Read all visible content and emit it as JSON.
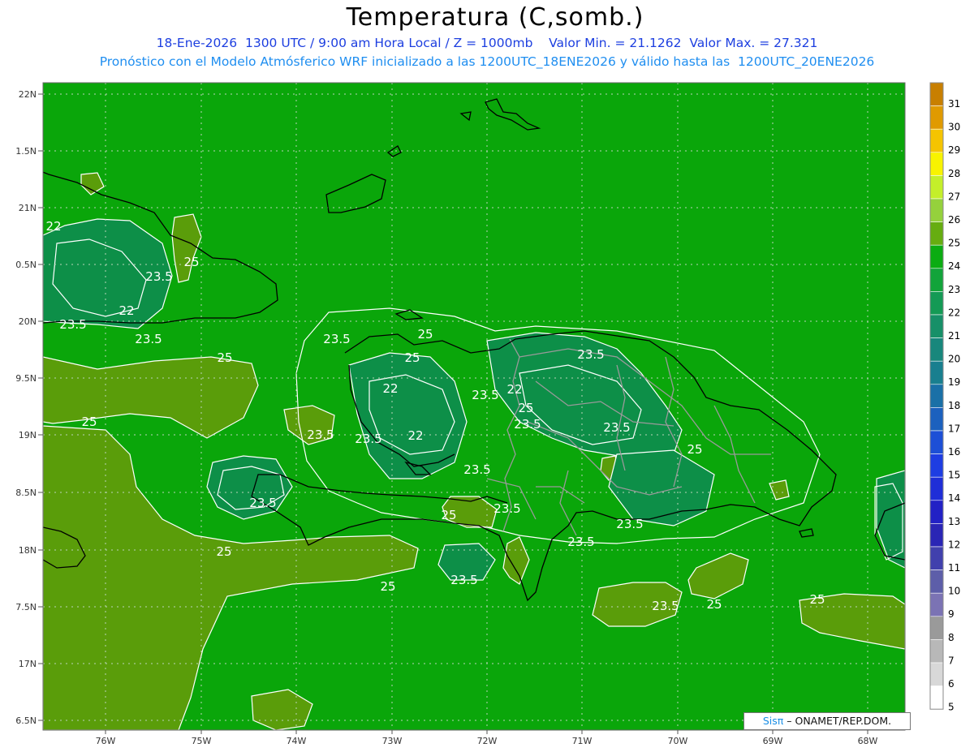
{
  "title": "Temperatura (C,somb.)",
  "subtitle_line1": "18-Ene-2026  1300 UTC / 9:00 am Hora Local / Z = 1000mb    Valor Min. = 21.1262  Valor Max. = 27.321",
  "subtitle_line2": "Pronóstico con el Modelo Atmósferico WRF inicializado a las 1200UTC_18ENE2026 y válido hasta las  1200UTC_20ENE2026",
  "credit": {
    "logo": "Sisπ",
    "text": " – ONAMET/REP.DOM."
  },
  "colors": {
    "sea_green": "#0aa60a",
    "warm_green": "#5a9d0a",
    "cool_green": "#0d8f48",
    "coast": "#000000",
    "borders": "#999999",
    "contour": "#ffffff"
  },
  "map": {
    "lat_labels": [
      "22N",
      "1.5N",
      "21N",
      "0.5N",
      "20N",
      "9.5N",
      "19N",
      "8.5N",
      "18N",
      "7.5N",
      "17N",
      "6.5N"
    ],
    "lon_labels": [
      "76W",
      "75W",
      "74W",
      "73W",
      "72W",
      "71W",
      "70W",
      "69W",
      "68W"
    ]
  },
  "contour_labels": [
    "22",
    "25",
    "23.5",
    "22",
    "23.5",
    "23.5",
    "23.5",
    "25",
    "25",
    "25",
    "25",
    "23.5",
    "23.5",
    "22",
    "22",
    "22",
    "23.5",
    "25",
    "23.5",
    "23.5",
    "23.5",
    "23.5",
    "25",
    "23.5",
    "25",
    "23.5",
    "25",
    "23.5",
    "23.5",
    "23.5",
    "25",
    "23.5",
    "25",
    "25",
    "25"
  ],
  "colorbar": {
    "labels": [
      "31",
      "30",
      "29",
      "28",
      "27",
      "26",
      "25",
      "24",
      "23",
      "22",
      "21",
      "20",
      "19",
      "18",
      "17",
      "16",
      "15",
      "14",
      "13",
      "12",
      "11",
      "10",
      "9",
      "8",
      "7",
      "6",
      "5"
    ],
    "colors": [
      "#c87f00",
      "#e09a00",
      "#f5c400",
      "#f8f300",
      "#c4ef2a",
      "#95d13c",
      "#66ad10",
      "#0bac12",
      "#12a43a",
      "#149a55",
      "#179068",
      "#18877c",
      "#197f8f",
      "#1a70a7",
      "#1c61be",
      "#1d4fd6",
      "#1e3de2",
      "#1f2ed7",
      "#2221c5",
      "#2a25b5",
      "#4140ad",
      "#5d5ea9",
      "#7b73b4",
      "#9a9a9a",
      "#b8b8b8",
      "#d8d8d8",
      "#ffffff"
    ]
  }
}
